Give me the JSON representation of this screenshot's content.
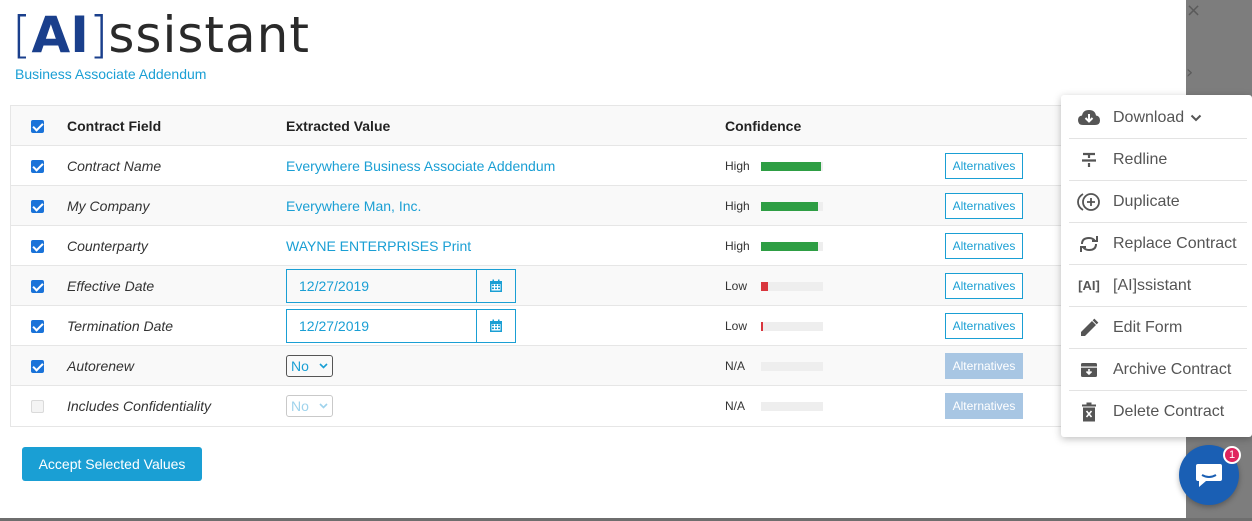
{
  "logo": {
    "bracket_open": "[",
    "ai": "AI",
    "bracket_close": "]",
    "rest": "ssistant"
  },
  "subtitle": "Business Associate Addendum",
  "table": {
    "headers": {
      "field": "Contract Field",
      "value": "Extracted Value",
      "confidence": "Confidence"
    },
    "rows": [
      {
        "checked": true,
        "field": "Contract Name",
        "value": "Everywhere Business Associate Addendum",
        "confidence": "High",
        "conf_level": 1.0,
        "conf_color": "#2e9e44",
        "alternatives": "Alternatives",
        "alt_disabled": false
      },
      {
        "checked": true,
        "field": "My Company",
        "value": "Everywhere Man, Inc.",
        "confidence": "High",
        "conf_level": 0.95,
        "conf_color": "#2e9e44",
        "alternatives": "Alternatives",
        "alt_disabled": false
      },
      {
        "checked": true,
        "field": "Counterparty",
        "value": "WAYNE ENTERPRISES Print",
        "confidence": "High",
        "conf_level": 0.95,
        "conf_color": "#2e9e44",
        "alternatives": "Alternatives",
        "alt_disabled": false
      },
      {
        "checked": true,
        "field": "Effective Date",
        "value": "12/27/2019",
        "confidence": "Low",
        "conf_level": 0.12,
        "conf_color": "#d9363e",
        "alternatives": "Alternatives",
        "alt_disabled": false
      },
      {
        "checked": true,
        "field": "Termination Date",
        "value": "12/27/2019",
        "confidence": "Low",
        "conf_level": 0.03,
        "conf_color": "#d9363e",
        "alternatives": "Alternatives",
        "alt_disabled": false
      },
      {
        "checked": true,
        "field": "Autorenew",
        "value": "No",
        "confidence": "N/A",
        "conf_level": 0,
        "conf_color": "#d9363e",
        "alternatives": "Alternatives",
        "alt_disabled": true
      },
      {
        "checked": false,
        "field": "Includes Confidentiality",
        "value": "No",
        "confidence": "N/A",
        "conf_level": 0,
        "conf_color": "#d9363e",
        "alternatives": "Alternatives",
        "alt_disabled": true
      }
    ]
  },
  "accept_button": "Accept Selected Values",
  "menu": {
    "items": [
      {
        "label": "Download",
        "icon": "cloud-download-icon"
      },
      {
        "label": "Redline",
        "icon": "strikethrough-icon"
      },
      {
        "label": "Duplicate",
        "icon": "plus-circle-icon"
      },
      {
        "label": "Replace Contract",
        "icon": "refresh-icon"
      },
      {
        "label": "[AI]ssistant",
        "icon": "ai-icon",
        "icon_text": "[AI]"
      },
      {
        "label": "Edit Form",
        "icon": "pencil-icon"
      },
      {
        "label": "Archive Contract",
        "icon": "archive-icon"
      },
      {
        "label": "Delete Contract",
        "icon": "trash-icon"
      }
    ]
  },
  "chat": {
    "badge": "1"
  },
  "colors": {
    "accent": "#1a9fd4",
    "brand": "#1a3f8c",
    "high": "#2e9e44",
    "low": "#d9363e"
  }
}
